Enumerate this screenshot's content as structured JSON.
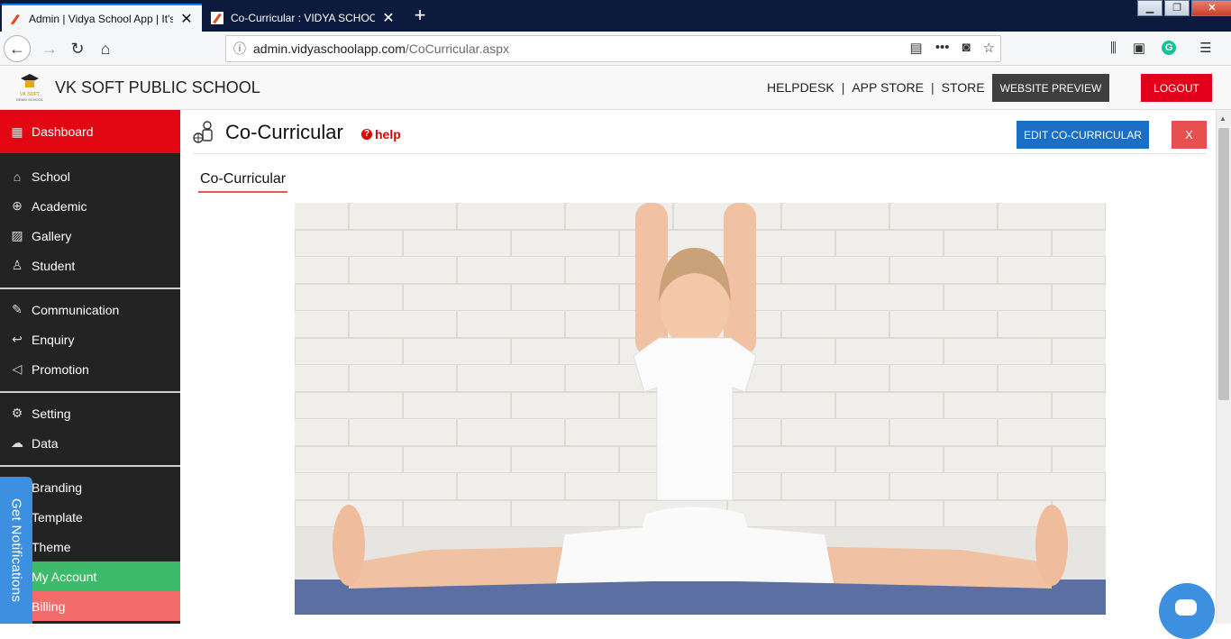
{
  "browser": {
    "tabs": [
      {
        "title": "Admin | Vidya School App | It's",
        "active": true
      },
      {
        "title": "Co-Curricular : VIDYA SCHOOL",
        "active": false
      }
    ],
    "url_host": "admin.vidyaschoolapp.com",
    "url_path": "/CoCurricular.aspx"
  },
  "header": {
    "school_name": "VK SOFT PUBLIC SCHOOL",
    "nav": [
      "HELPDESK",
      "APP STORE",
      "STORE"
    ],
    "website_preview_label": "WEBSITE PREVIEW",
    "logout_label": "LOGOUT",
    "logo_text": "VK SOFT DEMO SCHOOL"
  },
  "sidebar": {
    "items": [
      {
        "label": "Dashboard",
        "icon": "grid-icon"
      },
      {
        "label": "School",
        "icon": "school-icon"
      },
      {
        "label": "Academic",
        "icon": "globe-icon"
      },
      {
        "label": "Gallery",
        "icon": "image-icon"
      },
      {
        "label": "Student",
        "icon": "student-icon"
      },
      {
        "label": "Communication",
        "icon": "pencil-icon"
      },
      {
        "label": "Enquiry",
        "icon": "reply-icon"
      },
      {
        "label": "Promotion",
        "icon": "megaphone-icon"
      },
      {
        "label": "Setting",
        "icon": "gear-icon"
      },
      {
        "label": "Data",
        "icon": "cloud-icon"
      },
      {
        "label": "Branding",
        "icon": "brand-icon"
      },
      {
        "label": "Template",
        "icon": "template-icon"
      },
      {
        "label": "Theme",
        "icon": "theme-icon"
      },
      {
        "label": "My Account",
        "icon": "account-icon"
      },
      {
        "label": "Billing",
        "icon": "billing-icon"
      }
    ],
    "notifications_label": "Get Notifications"
  },
  "main": {
    "title": "Co-Curricular",
    "help_label": "help",
    "edit_label": "EDIT CO-CURRICULAR",
    "close_label": "X",
    "subtab_label": "Co-Curricular"
  },
  "colors": {
    "dashboard_active": "#e30613",
    "my_account": "#3dbb6b",
    "billing": "#f26a6a",
    "edit_button": "#1a6fc4",
    "logout_button": "#e2001a",
    "notif_tab": "#3d8fe0"
  }
}
